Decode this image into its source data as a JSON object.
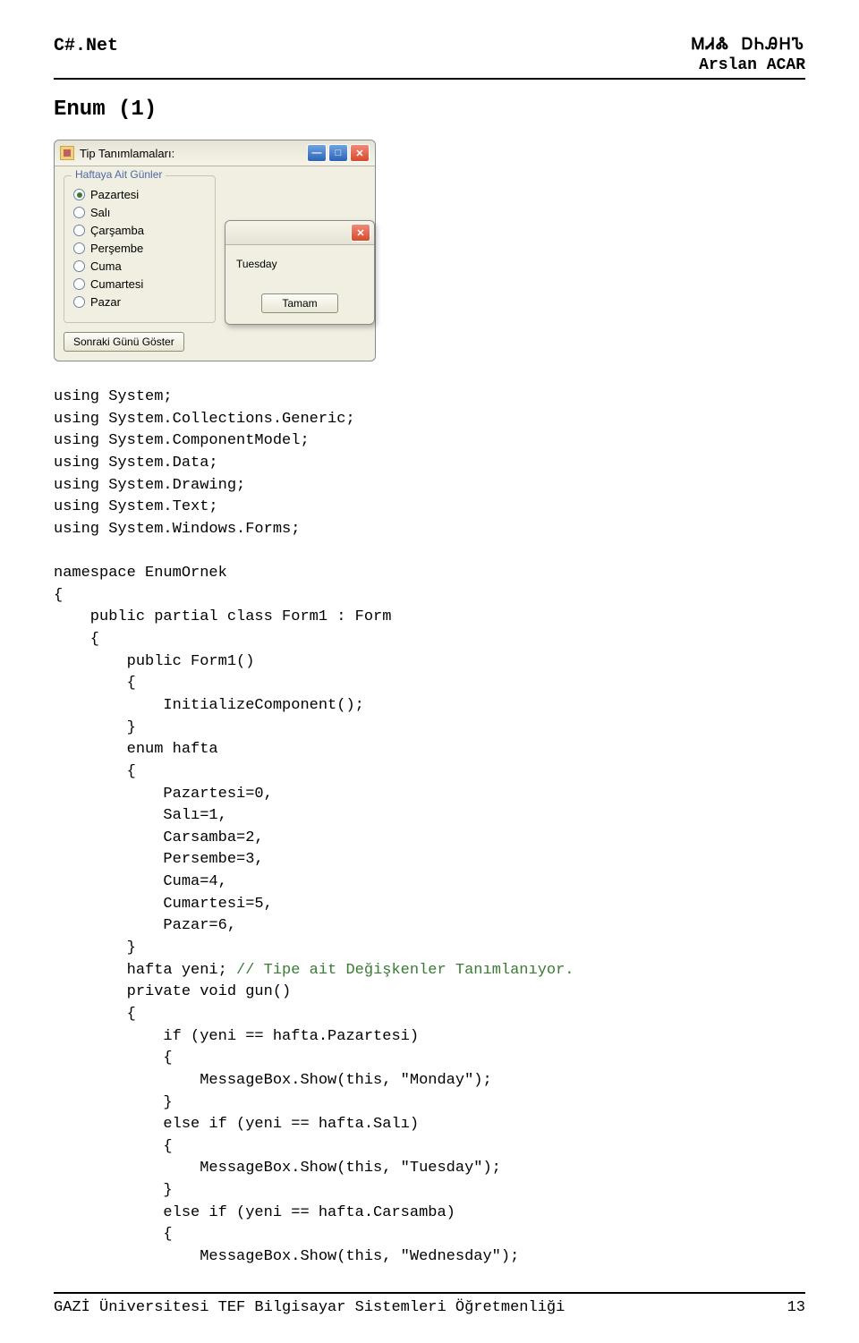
{
  "header": {
    "left": "C#.Net",
    "glyphs": "ᎷᏗᏜ   ᎠᏂᎯᎻᏖ",
    "author": "Arslan ACAR"
  },
  "title": "Enum (1)",
  "window": {
    "title": "Tip Tanımlamaları:",
    "legend": "Haftaya Ait Günler",
    "options": [
      "Pazartesi",
      "Salı",
      "Çarşamba",
      "Perşembe",
      "Cuma",
      "Cumartesi",
      "Pazar"
    ],
    "selectedIndex": 0,
    "nextButton": "Sonraki Günü Göster"
  },
  "dialog": {
    "message": "Tuesday",
    "ok": "Tamam"
  },
  "code": {
    "l1": "using System;",
    "l2": "using System.Collections.Generic;",
    "l3": "using System.ComponentModel;",
    "l4": "using System.Data;",
    "l5": "using System.Drawing;",
    "l6": "using System.Text;",
    "l7": "using System.Windows.Forms;",
    "l8": "",
    "l9": "namespace EnumOrnek",
    "l10": "{",
    "l11": "    public partial class Form1 : Form",
    "l12": "    {",
    "l13": "        public Form1()",
    "l14": "        {",
    "l15": "            InitializeComponent();",
    "l16": "        }",
    "l17": "        enum hafta",
    "l18": "        {",
    "l19": "            Pazartesi=0,",
    "l20": "            Salı=1,",
    "l21": "            Carsamba=2,",
    "l22": "            Persembe=3,",
    "l23": "            Cuma=4,",
    "l24": "            Cumartesi=5,",
    "l25": "            Pazar=6,",
    "l26": "        }",
    "l27_a": "        hafta yeni; ",
    "l27_b": "// Tipe ait Değişkenler Tanımlanıyor.",
    "l28": "        private void gun()",
    "l29": "        {",
    "l30": "            if (yeni == hafta.Pazartesi)",
    "l31": "            {",
    "l32": "                MessageBox.Show(this, \"Monday\");",
    "l33": "            }",
    "l34": "            else if (yeni == hafta.Salı)",
    "l35": "            {",
    "l36": "                MessageBox.Show(this, \"Tuesday\");",
    "l37": "            }",
    "l38": "            else if (yeni == hafta.Carsamba)",
    "l39": "            {",
    "l40": "                MessageBox.Show(this, \"Wednesday\");"
  },
  "footer": {
    "text": "GAZİ Üniversitesi TEF Bilgisayar Sistemleri Öğretmenliği",
    "page": "13"
  }
}
